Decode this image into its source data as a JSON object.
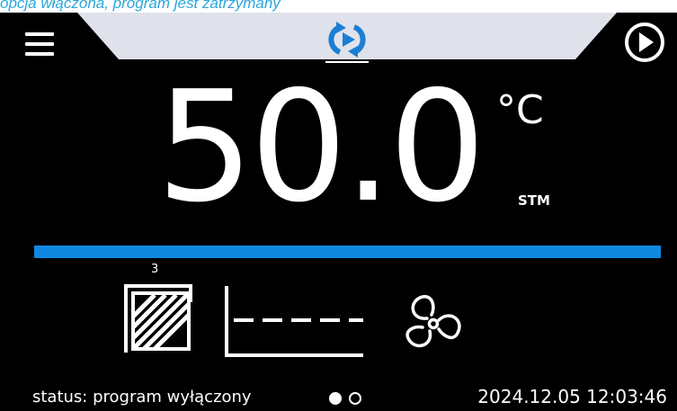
{
  "caption": "opcja włączona, program jest zatrzymany",
  "header": {
    "menu_icon": "hamburger-menu-icon",
    "mode_icon": "cyclic-mode-icon",
    "play_icon": "play-circle-icon"
  },
  "reading": {
    "value": "50.0",
    "unit": "°C",
    "mode": "STM"
  },
  "progress": {
    "fill_fraction": 1.0,
    "color": "#1188e0"
  },
  "indicators": {
    "door_count": "3",
    "door_icon": "door-opening-icon",
    "graph_icon": "temperature-graph-icon",
    "fan_icon": "fan-icon"
  },
  "footer": {
    "status": "status: program wyłączony",
    "page_indicator": {
      "pages": 2,
      "active": 1
    },
    "datetime": "2024.12.05  12:03:46"
  },
  "colors": {
    "background": "#000000",
    "header_tab": "#dfe2ea",
    "accent_blue": "#1188e0",
    "caption_blue": "#2aa7dd"
  }
}
